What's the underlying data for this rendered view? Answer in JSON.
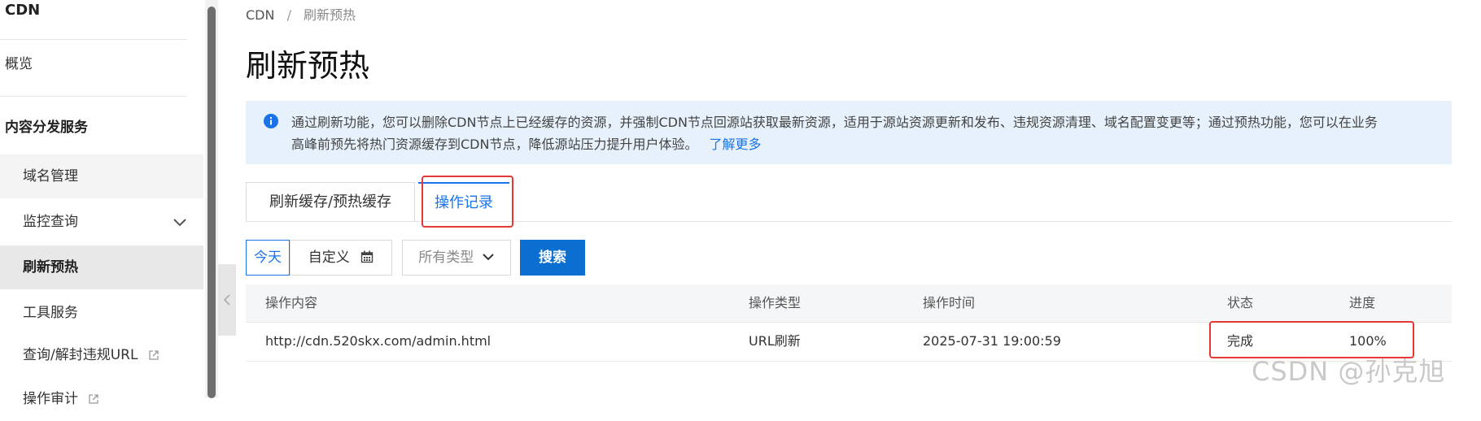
{
  "sidebar": {
    "title": "CDN",
    "overview": "概览",
    "section": "内容分发服务",
    "items": [
      {
        "label": "域名管理"
      },
      {
        "label": "监控查询"
      },
      {
        "label": "刷新预热"
      },
      {
        "label": "工具服务"
      },
      {
        "label": "查询/解封违规URL"
      },
      {
        "label": "操作审计"
      }
    ]
  },
  "breadcrumb": {
    "root": "CDN",
    "separator": "/",
    "current": "刷新预热"
  },
  "page_title": "刷新预热",
  "info": {
    "line1": "通过刷新功能，您可以删除CDN节点上已经缓存的资源，并强制CDN节点回源站获取最新资源，适用于源站资源更新和发布、违规资源清理、域名配置变更等；通过预热功能，您可以在业务",
    "line2": "高峰前预先将热门资源缓存到CDN节点，降低源站压力提升用户体验。",
    "link": "了解更多"
  },
  "tabs": [
    {
      "label": "刷新缓存/预热缓存"
    },
    {
      "label": "操作记录"
    }
  ],
  "filters": {
    "today": "今天",
    "custom": "自定义",
    "type": "所有类型",
    "search": "搜索"
  },
  "table": {
    "columns": [
      "操作内容",
      "操作类型",
      "操作时间",
      "状态",
      "进度"
    ],
    "rows": [
      [
        "http://cdn.520skx.com/admin.html",
        "URL刷新",
        "2025-07-31 19:00:59",
        "完成",
        "100%"
      ]
    ]
  },
  "watermark": "CSDN @孙克旭",
  "colors": {
    "accent": "#1a73e8",
    "primary_button": "#0a6fd0",
    "highlight_box": "#e53935",
    "info_bg": "#e6f1fb"
  }
}
